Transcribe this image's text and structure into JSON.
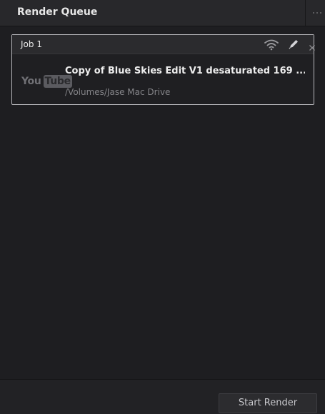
{
  "panel": {
    "title": "Render Queue",
    "menu_icon": "more-dots-icon"
  },
  "jobs": [
    {
      "title": "Job 1",
      "icons": [
        "remote-render-icon",
        "edit-pencil-icon",
        "close-icon"
      ],
      "preset_logo": "YouTube",
      "preset_logo_parts": [
        "You",
        "Tube"
      ],
      "name": "Copy of Blue Skies Edit V1 desaturated 169 ...",
      "path": "/Volumes/Jase Mac Drive"
    }
  ],
  "footer": {
    "start_render_label": "Start Render"
  },
  "colors": {
    "panel_bg": "#1e1e21",
    "header_bg": "#28282b",
    "job_border_selected": "#b8b8bc",
    "text_primary": "#ededed",
    "text_secondary": "#858589"
  }
}
